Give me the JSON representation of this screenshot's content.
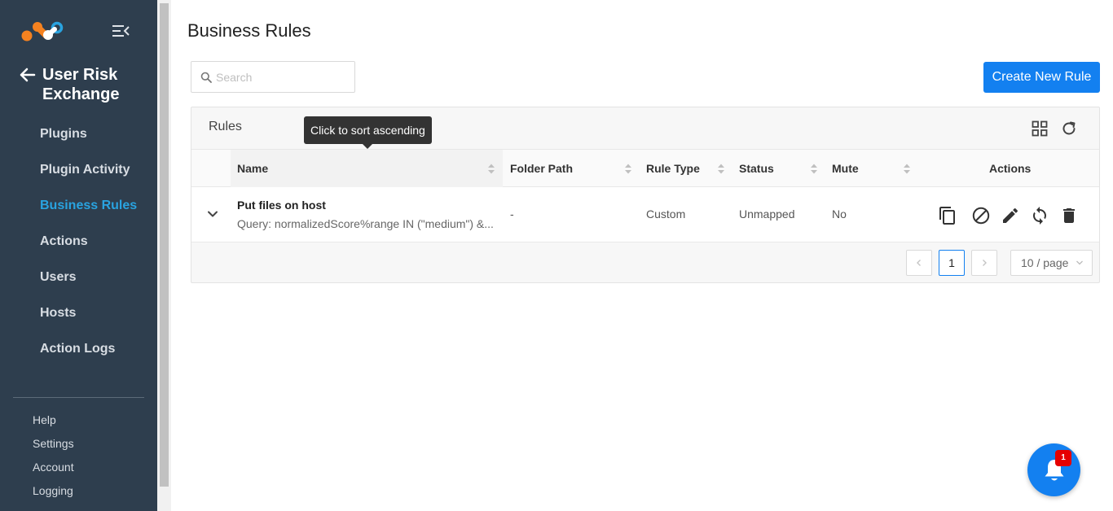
{
  "sidebar": {
    "section_title": "User Risk Exchange",
    "items": [
      {
        "label": "Plugins"
      },
      {
        "label": "Plugin Activity"
      },
      {
        "label": "Business Rules",
        "active": true
      },
      {
        "label": "Actions"
      },
      {
        "label": "Users"
      },
      {
        "label": "Hosts"
      },
      {
        "label": "Action Logs"
      }
    ],
    "bottom_links": [
      {
        "label": "Help"
      },
      {
        "label": "Settings"
      },
      {
        "label": "Account"
      },
      {
        "label": "Logging"
      }
    ],
    "background": "#2e3e4e",
    "active_color": "#29a3e0"
  },
  "main": {
    "title": "Business Rules",
    "search": {
      "placeholder": "Search",
      "value": ""
    },
    "create_button": "Create New Rule",
    "accent": "#1380f0"
  },
  "card": {
    "title": "Rules",
    "tooltip": "Click to sort ascending",
    "columns": [
      "Name",
      "Folder Path",
      "Rule Type",
      "Status",
      "Mute",
      "Actions"
    ],
    "rows": [
      {
        "name": "Put files on host",
        "query": "Query: normalizedScore%range IN (\"medium\") &...",
        "folder_path": "-",
        "rule_type": "Custom",
        "status": "Unmapped",
        "mute": "No"
      }
    ],
    "action_icons": [
      "copy-icon",
      "disable-icon",
      "edit-icon",
      "sync-icon",
      "delete-icon"
    ],
    "pagination": {
      "current_page": "1",
      "page_size": "10 / page"
    }
  },
  "notifications": {
    "badge": "1"
  }
}
